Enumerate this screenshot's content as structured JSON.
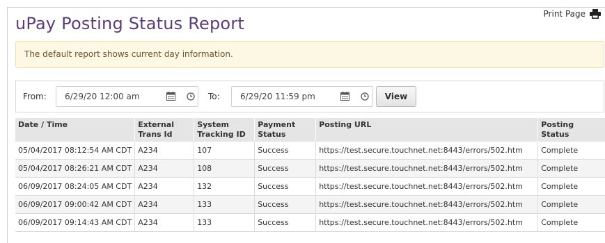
{
  "header": {
    "title": "uPay Posting Status Report",
    "print_label": "Print Page"
  },
  "notice": "The default report shows current day information.",
  "filter": {
    "from_label": "From:",
    "from_value": "6/29/20 12:00 am",
    "to_label": "To:",
    "to_value": "6/29/20 11:59 pm",
    "view_label": "View"
  },
  "table": {
    "columns": [
      "Date / Time",
      "External Trans Id",
      "System Tracking ID",
      "Payment Status",
      "Posting URL",
      "Posting Status"
    ],
    "rows": [
      [
        "05/04/2017 08:12:54 AM CDT",
        "A234",
        "107",
        "Success",
        "https://test.secure.touchnet.net:8443/errors/502.htm",
        "Complete"
      ],
      [
        "05/04/2017 08:26:21 AM CDT",
        "A234",
        "108",
        "Success",
        "https://test.secure.touchnet.net:8443/errors/502.htm",
        "Complete"
      ],
      [
        "06/09/2017 08:24:05 AM CDT",
        "A234",
        "132",
        "Success",
        "https://test.secure.touchnet.net:8443/errors/502.htm",
        "Complete"
      ],
      [
        "06/09/2017 09:00:42 AM CDT",
        "A234",
        "133",
        "Success",
        "https://test.secure.touchnet.net:8443/errors/502.htm",
        "Complete"
      ],
      [
        "06/09/2017 09:14:43 AM CDT",
        "A234",
        "133",
        "Success",
        "https://test.secure.touchnet.net:8443/errors/502.htm",
        "Complete"
      ]
    ]
  },
  "icons": {
    "print": "printer-icon",
    "calendar": "calendar-icon",
    "clock": "clock-icon"
  },
  "colors": {
    "title": "#5a3e7a",
    "notice_bg": "#fcf8e3",
    "header_bg": "#e5e5e5"
  }
}
